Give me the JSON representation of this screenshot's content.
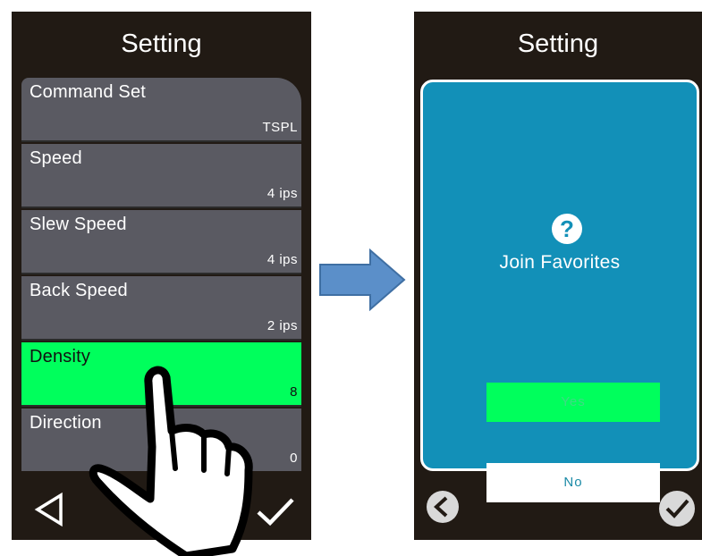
{
  "left_screen": {
    "title": "Setting",
    "items": [
      {
        "label": "Command Set",
        "value": "TSPL",
        "selected": false
      },
      {
        "label": "Speed",
        "value": "4 ips",
        "selected": false
      },
      {
        "label": "Slew Speed",
        "value": "4 ips",
        "selected": false
      },
      {
        "label": "Back Speed",
        "value": "2 ips",
        "selected": false
      },
      {
        "label": "Density",
        "value": "8",
        "selected": true
      },
      {
        "label": "Direction",
        "value": "0",
        "selected": false
      }
    ],
    "back_icon": "triangle-back-icon",
    "confirm_icon": "checkmark-icon",
    "gesture_icon": "pointing-hand-icon"
  },
  "transition_icon": "right-arrow-icon",
  "right_screen": {
    "title": "Setting",
    "dialog": {
      "icon": "question-mark-icon",
      "message": "Join Favorites",
      "yes_label": "Yes",
      "no_label": "No"
    },
    "back_icon": "circle-back-icon",
    "confirm_icon": "circle-check-icon"
  },
  "colors": {
    "screen_bg": "#211a14",
    "list_item": "#5a5a62",
    "selected": "#00ff5c",
    "dialog_bg": "#1290b8",
    "arrow_fill": "#5b8fc9"
  }
}
